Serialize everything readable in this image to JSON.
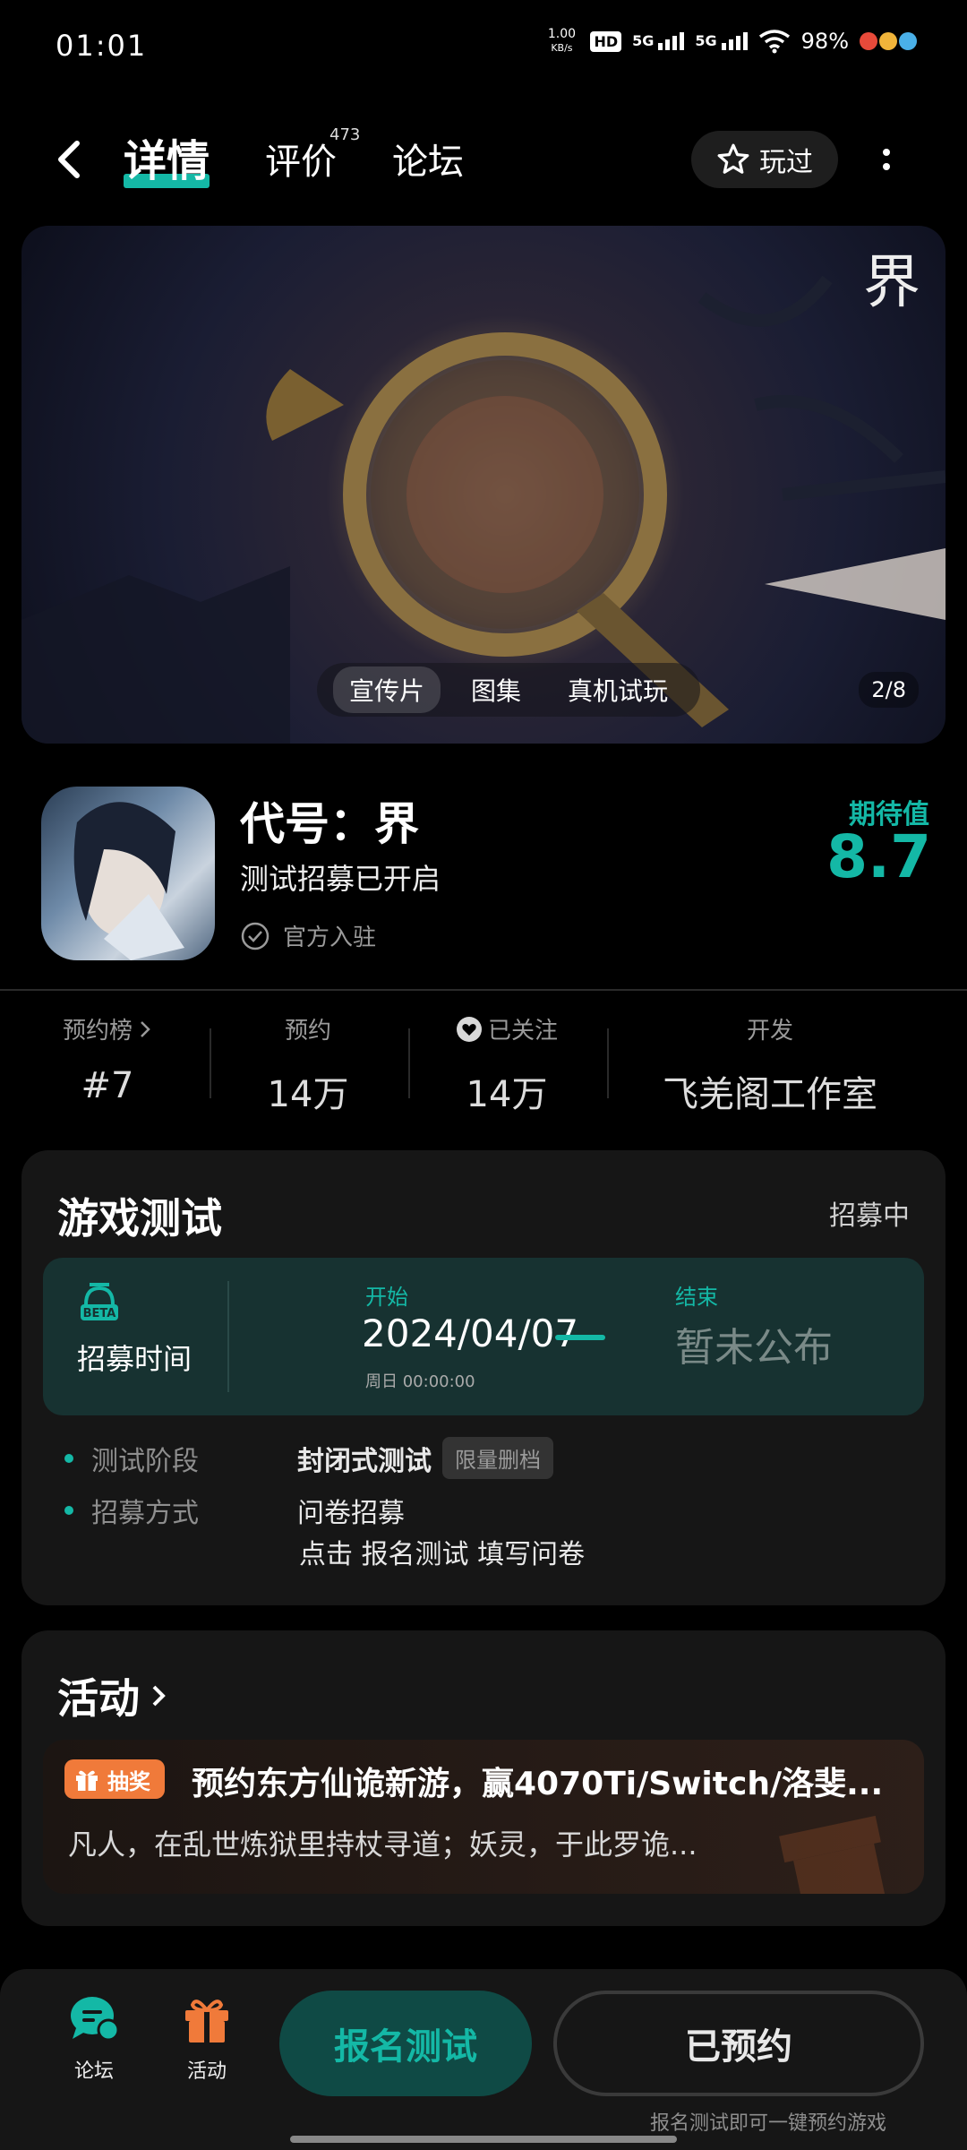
{
  "status": {
    "time": "01:01",
    "net_speed_value": "1.00",
    "net_speed_unit": "KB/s",
    "hd": "HD",
    "signal1": "5G",
    "signal2": "5G",
    "battery": "98%"
  },
  "nav": {
    "tab_detail": "详情",
    "tab_review": "评价",
    "review_count": "473",
    "tab_forum": "论坛",
    "played_label": "玩过"
  },
  "banner": {
    "logo_text": "界",
    "media_tabs": [
      "宣传片",
      "图集",
      "真机试玩"
    ],
    "counter": "2/8"
  },
  "game": {
    "title": "代号：界",
    "subtitle": "测试招募已开启",
    "official_label": "官方入驻",
    "expect_label": "期待值",
    "expect_value": "8.7"
  },
  "stats": [
    {
      "label": "预约榜",
      "value": "#7"
    },
    {
      "label": "预约",
      "value": "14万"
    },
    {
      "label": "已关注",
      "value": "14万"
    },
    {
      "label": "开发",
      "value": "飞羌阁工作室"
    }
  ],
  "test_card": {
    "title": "游戏测试",
    "status": "招募中",
    "beta_badge": "BETA",
    "beta_label": "招募时间",
    "start_label": "开始",
    "start_date": "2024/04/07",
    "start_time": "周日 00:00:00",
    "end_label": "结束",
    "end_value": "暂未公布",
    "stage_key": "测试阶段",
    "stage_value": "封闭式测试",
    "stage_tag": "限量删档",
    "method_key": "招募方式",
    "method_value": "问卷招募",
    "method_hint": "点击 报名测试 填写问卷"
  },
  "activity_card": {
    "title": "活动",
    "badge": "抽奖",
    "headline": "预约东方仙诡新游，赢4070Ti/Switch/洛斐...",
    "desc": "凡人，在乱世炼狱里持杖寻道；妖灵，于此罗诡..."
  },
  "bottom_bar": {
    "forum_label": "论坛",
    "activity_label": "活动",
    "signup_button": "报名测试",
    "reserved_button": "已预约",
    "hint": "报名测试即可一键预约游戏"
  },
  "colors": {
    "accent": "#14b8a6",
    "background": "#000000",
    "card": "#161616",
    "lottery": "#f07a3a"
  }
}
